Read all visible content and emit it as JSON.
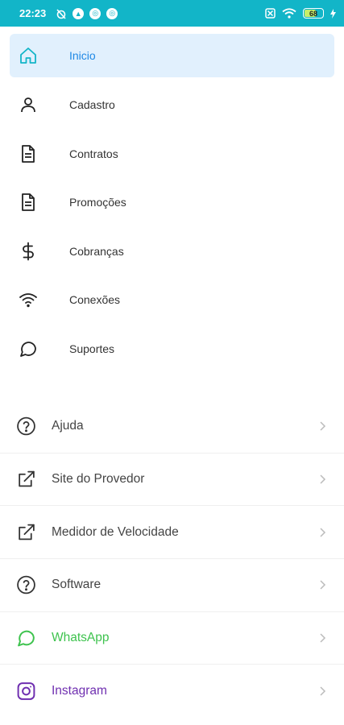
{
  "status_bar": {
    "time": "22:23",
    "battery_level": "68",
    "accent_color": "#12b5c8"
  },
  "menu": {
    "items": [
      {
        "label": "Inicio",
        "icon": "home-icon",
        "active": true
      },
      {
        "label": "Cadastro",
        "icon": "user-icon"
      },
      {
        "label": "Contratos",
        "icon": "document-icon"
      },
      {
        "label": "Promoções",
        "icon": "document-icon"
      },
      {
        "label": "Cobranças",
        "icon": "dollar-icon"
      },
      {
        "label": "Conexões",
        "icon": "wifi-icon"
      },
      {
        "label": "Suportes",
        "icon": "chat-bubble-icon"
      }
    ],
    "active_color": "#1e88e5",
    "active_bg": "#e1f0fd"
  },
  "links": {
    "items": [
      {
        "label": "Ajuda",
        "icon": "help-circle-icon"
      },
      {
        "label": "Site do Provedor",
        "icon": "external-link-icon"
      },
      {
        "label": "Medidor de Velocidade",
        "icon": "external-link-icon"
      },
      {
        "label": "Software",
        "icon": "help-circle-icon"
      },
      {
        "label": "WhatsApp",
        "icon": "whatsapp-icon",
        "color": "#3ec34e"
      },
      {
        "label": "Instagram",
        "icon": "instagram-icon",
        "color": "#6f2fb0"
      }
    ]
  }
}
